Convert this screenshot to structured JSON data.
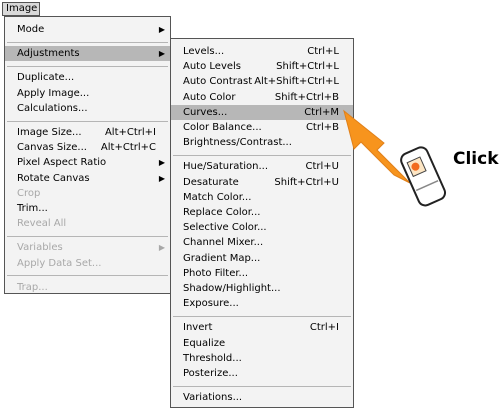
{
  "menu_bar": {
    "title": "Image"
  },
  "main_menu": [
    {
      "label": "Mode",
      "shortcut": "",
      "submenu": true,
      "disabled": false,
      "sep_before": false
    },
    {
      "label": "Adjustments",
      "shortcut": "",
      "submenu": true,
      "disabled": false,
      "sep_before": true,
      "highlight": true
    },
    {
      "label": "Duplicate...",
      "shortcut": "",
      "submenu": false,
      "disabled": false,
      "sep_before": true
    },
    {
      "label": "Apply Image...",
      "shortcut": "",
      "submenu": false,
      "disabled": false,
      "sep_before": false
    },
    {
      "label": "Calculations...",
      "shortcut": "",
      "submenu": false,
      "disabled": false,
      "sep_before": false
    },
    {
      "label": "Image Size...",
      "shortcut": "Alt+Ctrl+I",
      "submenu": false,
      "disabled": false,
      "sep_before": true
    },
    {
      "label": "Canvas Size...",
      "shortcut": "Alt+Ctrl+C",
      "submenu": false,
      "disabled": false,
      "sep_before": false
    },
    {
      "label": "Pixel Aspect Ratio",
      "shortcut": "",
      "submenu": true,
      "disabled": false,
      "sep_before": false
    },
    {
      "label": "Rotate Canvas",
      "shortcut": "",
      "submenu": true,
      "disabled": false,
      "sep_before": false
    },
    {
      "label": "Crop",
      "shortcut": "",
      "submenu": false,
      "disabled": true,
      "sep_before": false
    },
    {
      "label": "Trim...",
      "shortcut": "",
      "submenu": false,
      "disabled": false,
      "sep_before": false
    },
    {
      "label": "Reveal All",
      "shortcut": "",
      "submenu": false,
      "disabled": true,
      "sep_before": false
    },
    {
      "label": "Variables",
      "shortcut": "",
      "submenu": true,
      "disabled": true,
      "sep_before": true
    },
    {
      "label": "Apply Data Set...",
      "shortcut": "",
      "submenu": false,
      "disabled": true,
      "sep_before": false
    },
    {
      "label": "Trap...",
      "shortcut": "",
      "submenu": false,
      "disabled": true,
      "sep_before": true
    }
  ],
  "adjustments_menu": [
    {
      "label": "Levels...",
      "shortcut": "Ctrl+L",
      "sep_before": false
    },
    {
      "label": "Auto Levels",
      "shortcut": "Shift+Ctrl+L",
      "sep_before": false
    },
    {
      "label": "Auto Contrast",
      "shortcut": "Alt+Shift+Ctrl+L",
      "sep_before": false
    },
    {
      "label": "Auto Color",
      "shortcut": "Shift+Ctrl+B",
      "sep_before": false
    },
    {
      "label": "Curves...",
      "shortcut": "Ctrl+M",
      "sep_before": false,
      "highlight": true
    },
    {
      "label": "Color Balance...",
      "shortcut": "Ctrl+B",
      "sep_before": false
    },
    {
      "label": "Brightness/Contrast...",
      "shortcut": "",
      "sep_before": false
    },
    {
      "label": "Hue/Saturation...",
      "shortcut": "Ctrl+U",
      "sep_before": true
    },
    {
      "label": "Desaturate",
      "shortcut": "Shift+Ctrl+U",
      "sep_before": false
    },
    {
      "label": "Match Color...",
      "shortcut": "",
      "sep_before": false
    },
    {
      "label": "Replace Color...",
      "shortcut": "",
      "sep_before": false
    },
    {
      "label": "Selective Color...",
      "shortcut": "",
      "sep_before": false
    },
    {
      "label": "Channel Mixer...",
      "shortcut": "",
      "sep_before": false
    },
    {
      "label": "Gradient Map...",
      "shortcut": "",
      "sep_before": false
    },
    {
      "label": "Photo Filter...",
      "shortcut": "",
      "sep_before": false
    },
    {
      "label": "Shadow/Highlight...",
      "shortcut": "",
      "sep_before": false
    },
    {
      "label": "Exposure...",
      "shortcut": "",
      "sep_before": false
    },
    {
      "label": "Invert",
      "shortcut": "Ctrl+I",
      "sep_before": true
    },
    {
      "label": "Equalize",
      "shortcut": "",
      "sep_before": false
    },
    {
      "label": "Threshold...",
      "shortcut": "",
      "sep_before": false
    },
    {
      "label": "Posterize...",
      "shortcut": "",
      "sep_before": false
    },
    {
      "label": "Variations...",
      "shortcut": "",
      "sep_before": true
    }
  ],
  "annotation": {
    "click_label": "Click"
  },
  "colors": {
    "arrow": "#f7941d",
    "highlight": "#b7b7b7",
    "menu_bg": "#f3f3f3"
  }
}
